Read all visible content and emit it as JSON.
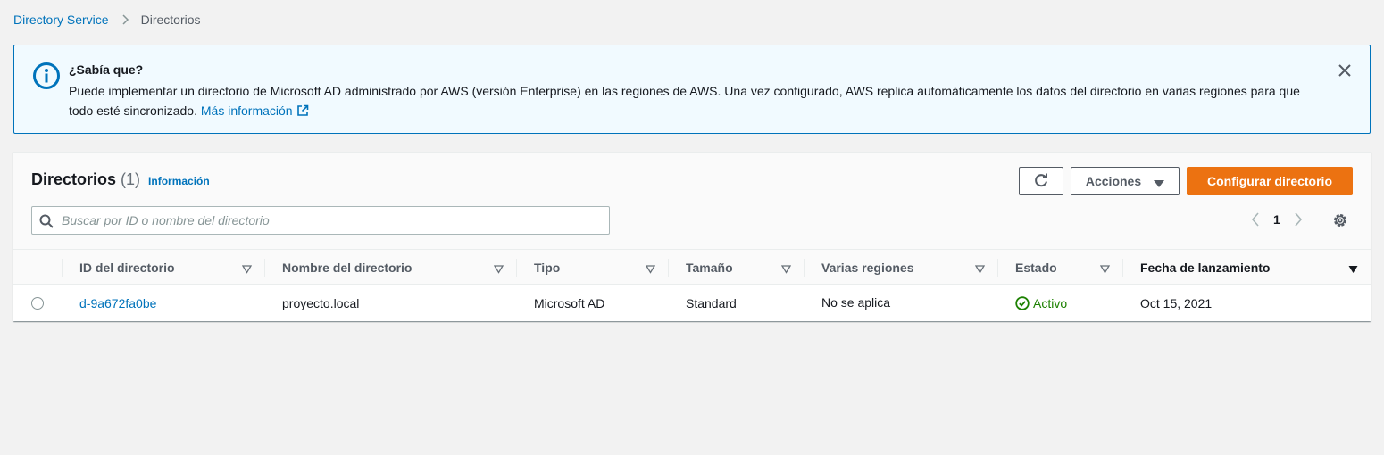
{
  "breadcrumb": {
    "parent": "Directory Service",
    "current": "Directorios"
  },
  "alert": {
    "title": "¿Sabía que?",
    "body": "Puede implementar un directorio de Microsoft AD administrado por AWS (versión Enterprise) en las regiones de AWS. Una vez configurado, AWS replica automáticamente los datos del directorio en varias regiones para que todo esté sincronizado.",
    "link": "Más información"
  },
  "panel": {
    "title": "Directorios",
    "count": "(1)",
    "info_link": "Información",
    "actions_label": "Acciones",
    "primary_label": "Configurar directorio",
    "search_placeholder": "Buscar por ID o nombre del directorio",
    "search_value": "",
    "page": "1"
  },
  "table": {
    "columns": [
      "ID del directorio",
      "Nombre del directorio",
      "Tipo",
      "Tamaño",
      "Varias regiones",
      "Estado",
      "Fecha de lanzamiento"
    ],
    "rows": [
      {
        "id": "d-9a672fa0be",
        "name": "proyecto.local",
        "type": "Microsoft AD",
        "size": "Standard",
        "multi_region": "No se aplica",
        "status": "Activo",
        "launch_date": "Oct 15, 2021"
      }
    ]
  },
  "colors": {
    "link": "#0073bb",
    "primary": "#ec7211",
    "success": "#1d8102",
    "alert_bg": "#f1faff"
  }
}
